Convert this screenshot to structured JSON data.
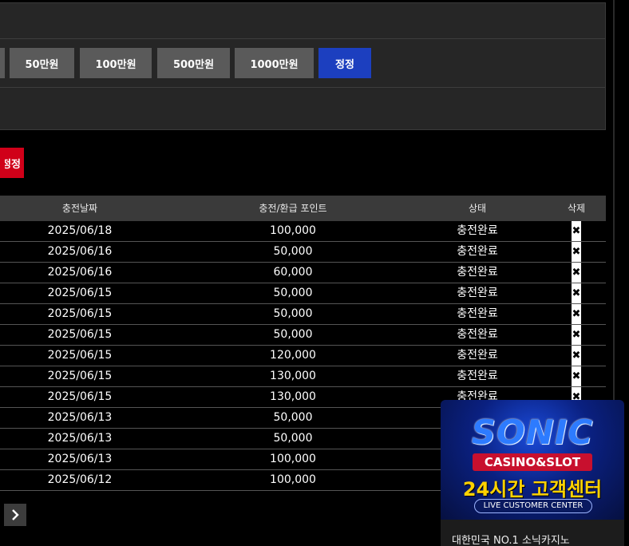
{
  "amount_buttons": {
    "b50": "50만원",
    "b100": "100만원",
    "b500": "500만원",
    "b1000": "1000만원",
    "correct": "정정"
  },
  "red_button": "정정",
  "table": {
    "headers": {
      "date": "충전날짜",
      "points": "충전/환급 포인트",
      "status": "상태",
      "delete": "삭제"
    },
    "rows": [
      {
        "date": "2025/06/18",
        "points": "100,000",
        "status": "충전완료"
      },
      {
        "date": "2025/06/16",
        "points": "50,000",
        "status": "충전완료"
      },
      {
        "date": "2025/06/16",
        "points": "60,000",
        "status": "충전완료"
      },
      {
        "date": "2025/06/15",
        "points": "50,000",
        "status": "충전완료"
      },
      {
        "date": "2025/06/15",
        "points": "50,000",
        "status": "충전완료"
      },
      {
        "date": "2025/06/15",
        "points": "50,000",
        "status": "충전완료"
      },
      {
        "date": "2025/06/15",
        "points": "120,000",
        "status": "충전완료"
      },
      {
        "date": "2025/06/15",
        "points": "130,000",
        "status": "충전완료"
      },
      {
        "date": "2025/06/15",
        "points": "130,000",
        "status": "충전완료"
      },
      {
        "date": "2025/06/13",
        "points": "50,000",
        "status": ""
      },
      {
        "date": "2025/06/13",
        "points": "50,000",
        "status": ""
      },
      {
        "date": "2025/06/13",
        "points": "100,000",
        "status": ""
      },
      {
        "date": "2025/06/12",
        "points": "100,000",
        "status": ""
      }
    ],
    "delete_glyph": "✖"
  },
  "pagination": {
    "next_glyph": "›"
  },
  "banner": {
    "brand": "SONIC",
    "sub": "CASINO&SLOT",
    "hours": "24시간 고객센터",
    "live": "LIVE CUSTOMER CENTER",
    "caption": "대한민국 NO.1 소닉카지노"
  }
}
